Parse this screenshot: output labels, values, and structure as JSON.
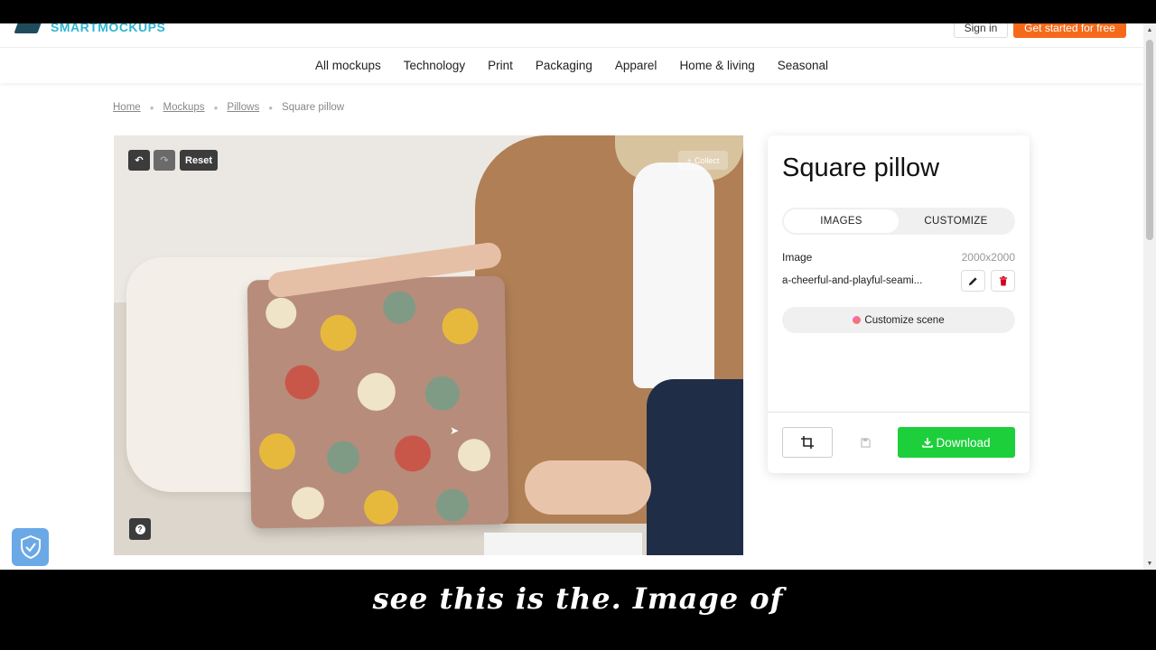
{
  "header": {
    "logo_text": "SMARTMOCKUPS",
    "signin_label": "Sign in",
    "getstarted_label": "Get started for free"
  },
  "nav": {
    "items": [
      "All mockups",
      "Technology",
      "Print",
      "Packaging",
      "Apparel",
      "Home & living",
      "Seasonal"
    ]
  },
  "breadcrumb": {
    "items": [
      "Home",
      "Mockups",
      "Pillows"
    ],
    "current": "Square pillow"
  },
  "preview": {
    "reset_label": "Reset",
    "collect_label": "Collect"
  },
  "panel": {
    "title": "Square pillow",
    "tabs": [
      {
        "label": "IMAGES",
        "active": true
      },
      {
        "label": "CUSTOMIZE",
        "active": false
      }
    ],
    "image_label": "Image",
    "image_size": "2000x2000",
    "file_name": "a-cheerful-and-playful-seami...",
    "customize_scene_label": "Customize scene",
    "download_label": "Download"
  },
  "colors": {
    "accent_orange": "#f56a1a",
    "download_green": "#1ecf3c",
    "logo_cyan": "#2fb5d6",
    "delete_red": "#d0021b"
  },
  "caption": {
    "text": "see this is the. Image of"
  }
}
